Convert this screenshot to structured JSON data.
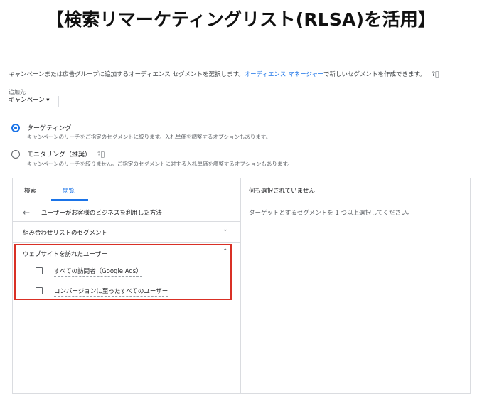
{
  "header": {
    "title": "【検索リマーケティングリスト(RLSA)を活用】"
  },
  "intro": {
    "text": "キャンペーンまたは広告グループに追加するオーディエンス セグメントを選択します。",
    "link": "オーディエンス マネージャー",
    "text_after": "で新しいセグメントを作成できます。"
  },
  "add_to": {
    "label": "追加先",
    "value": "キャンペーン ▾"
  },
  "options": [
    {
      "title": "ターゲティング",
      "subtitle": "キャンペーンのリーチをご指定のセグメントに絞ります。入札単価を調整するオプションもあります。",
      "selected": true
    },
    {
      "title": "モニタリング（推奨）",
      "subtitle": "キャンペーンのリーチを絞りません。ご指定のセグメントに対する入札単価を調整するオプションもあります。",
      "selected": false
    }
  ],
  "tabs": [
    {
      "label": "検索"
    },
    {
      "label": "閲覧"
    }
  ],
  "browse": {
    "back_title": "ユーザーがお客様のビジネスを利用した方法",
    "section1": "組み合わせリストのセグメント",
    "section2": "ウェブサイトを訪れたユーザー",
    "items": [
      {
        "label": "すべての訪問者（Google Ads）",
        "checked": false
      },
      {
        "label": "コンバージョンに至ったすべてのユーザー",
        "checked": false
      }
    ]
  },
  "right_panel": {
    "header": "何も選択されていません",
    "hint": "ターゲットとするセグメントを 1 つ以上選択してください。"
  },
  "colors": {
    "accent": "#1a73e8",
    "highlight": "#d93025"
  },
  "icons": {
    "help": "help-circle-icon",
    "back": "arrow-back-icon",
    "expand": "chevron-down-icon",
    "collapse": "chevron-up-icon"
  }
}
